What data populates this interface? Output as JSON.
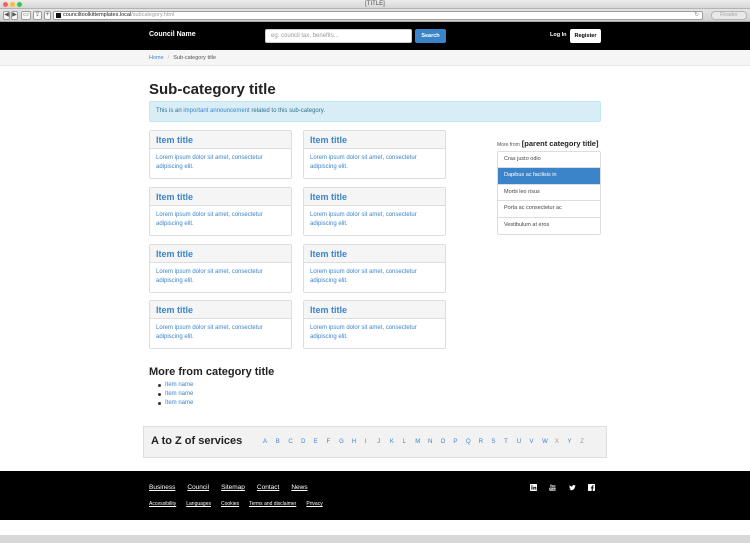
{
  "browser": {
    "window_title": "[TITLE]",
    "url_host": "counciltoolkittemplates.local",
    "url_path": "/subcategory.html",
    "reader_label": "Reader"
  },
  "header": {
    "brand": "Council Name",
    "search_placeholder": "eg. council tax, benefits...",
    "search_button": "Search",
    "login": "Log In",
    "register": "Register"
  },
  "breadcrumb": {
    "home": "Home",
    "current": "Sub-category title"
  },
  "main": {
    "title": "Sub-category title",
    "announcement": {
      "before": "This is an ",
      "link": "important announcement",
      "after": " related to this sub-category."
    },
    "cards": [
      {
        "title": "Item title",
        "text": "Lorem ipsum dolor sit amet, consectetur adipiscing elit."
      },
      {
        "title": "Item title",
        "text": "Lorem ipsum dolor sit amet, consectetur adipiscing elit."
      },
      {
        "title": "Item title",
        "text": "Lorem ipsum dolor sit amet, consectetur adipiscing elit."
      },
      {
        "title": "Item title",
        "text": "Lorem ipsum dolor sit amet, consectetur adipiscing elit."
      },
      {
        "title": "Item title",
        "text": "Lorem ipsum dolor sit amet, consectetur adipiscing elit."
      },
      {
        "title": "Item title",
        "text": "Lorem ipsum dolor sit amet, consectetur adipiscing elit."
      },
      {
        "title": "Item title",
        "text": "Lorem ipsum dolor sit amet, consectetur adipiscing elit."
      },
      {
        "title": "Item title",
        "text": "Lorem ipsum dolor sit amet, consectetur adipiscing elit."
      }
    ]
  },
  "sidebar": {
    "prefix": "More from",
    "heading": "[parent category title]",
    "items": [
      {
        "label": "Cras justo odio",
        "active": false
      },
      {
        "label": "Dapibus ac facilisis in",
        "active": true
      },
      {
        "label": "Morbi leo risus",
        "active": false
      },
      {
        "label": "Porta ac consectetur ac",
        "active": false
      },
      {
        "label": "Vestibulum at eros",
        "active": false
      }
    ]
  },
  "more_from": {
    "title": "More from category title",
    "items": [
      "Item name",
      "Item name",
      "Item name"
    ]
  },
  "a_to_z": {
    "title": "A to Z of services",
    "letters": [
      "A",
      "B",
      "C",
      "D",
      "E",
      "F",
      "G",
      "H",
      "I",
      "J",
      "K",
      "L",
      "M",
      "N",
      "O",
      "P",
      "Q",
      "R",
      "S",
      "T",
      "U",
      "V",
      "W",
      "X",
      "Y",
      "Z"
    ],
    "inactive": [
      "X",
      "Z"
    ]
  },
  "footer": {
    "nav": [
      "Business",
      "Council",
      "Sitemap",
      "Contact",
      "News"
    ],
    "sub": [
      "Accessibility",
      "Languages",
      "Cookies",
      "Terms and disclaimer",
      "Privacy"
    ],
    "social_icons": [
      "linkedin-icon",
      "youtube-icon",
      "twitter-icon",
      "facebook-icon"
    ]
  },
  "colors": {
    "accent": "#3c84c9",
    "header_bg": "#000000",
    "announcement_bg": "#d9edf7"
  }
}
